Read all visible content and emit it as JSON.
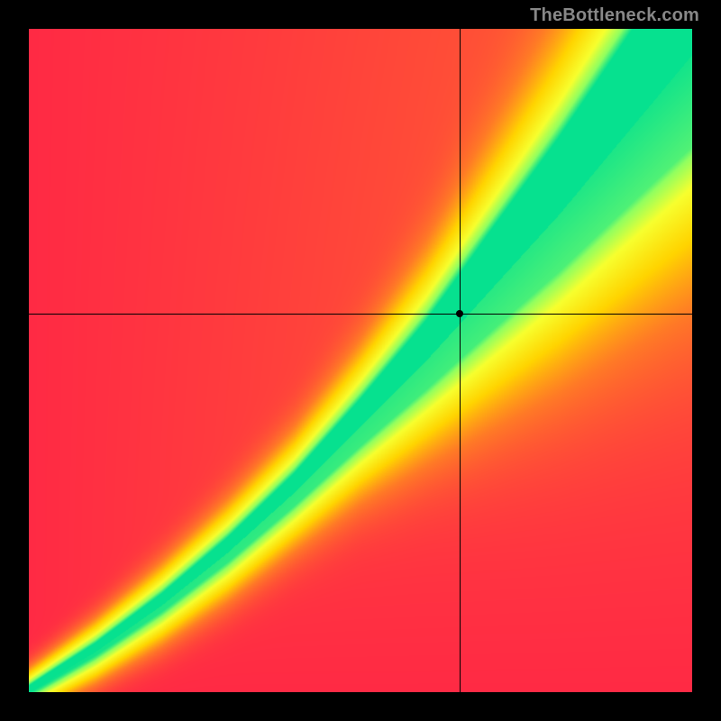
{
  "watermark": {
    "text": "TheBottleneck.com"
  },
  "chart_data": {
    "type": "heatmap",
    "title": "",
    "xlabel": "",
    "ylabel": "",
    "xlim": [
      0,
      100
    ],
    "ylim": [
      0,
      100
    ],
    "crosshair": {
      "x": 65,
      "y": 57
    },
    "marker": {
      "x": 65,
      "y": 57
    },
    "colorscale": [
      {
        "stop": 0.0,
        "color": "#ff2a44"
      },
      {
        "stop": 0.3,
        "color": "#ff7a26"
      },
      {
        "stop": 0.55,
        "color": "#ffd400"
      },
      {
        "stop": 0.78,
        "color": "#f7ff2e"
      },
      {
        "stop": 0.92,
        "color": "#90ff60"
      },
      {
        "stop": 1.0,
        "color": "#06e18f"
      }
    ],
    "optimal_band": {
      "description": "Green/optimal ridge along a slightly convex diagonal; band widens toward upper-right.",
      "curve_points": [
        {
          "x": 0,
          "y": 0,
          "half_width": 1.5
        },
        {
          "x": 10,
          "y": 6,
          "half_width": 2.0
        },
        {
          "x": 20,
          "y": 13,
          "half_width": 2.5
        },
        {
          "x": 30,
          "y": 21,
          "half_width": 3.0
        },
        {
          "x": 40,
          "y": 30,
          "half_width": 3.5
        },
        {
          "x": 50,
          "y": 40,
          "half_width": 4.5
        },
        {
          "x": 60,
          "y": 50,
          "half_width": 6.0
        },
        {
          "x": 70,
          "y": 61,
          "half_width": 8.0
        },
        {
          "x": 80,
          "y": 72,
          "half_width": 10.0
        },
        {
          "x": 90,
          "y": 84,
          "half_width": 12.0
        },
        {
          "x": 100,
          "y": 96,
          "half_width": 14.0
        }
      ]
    }
  }
}
